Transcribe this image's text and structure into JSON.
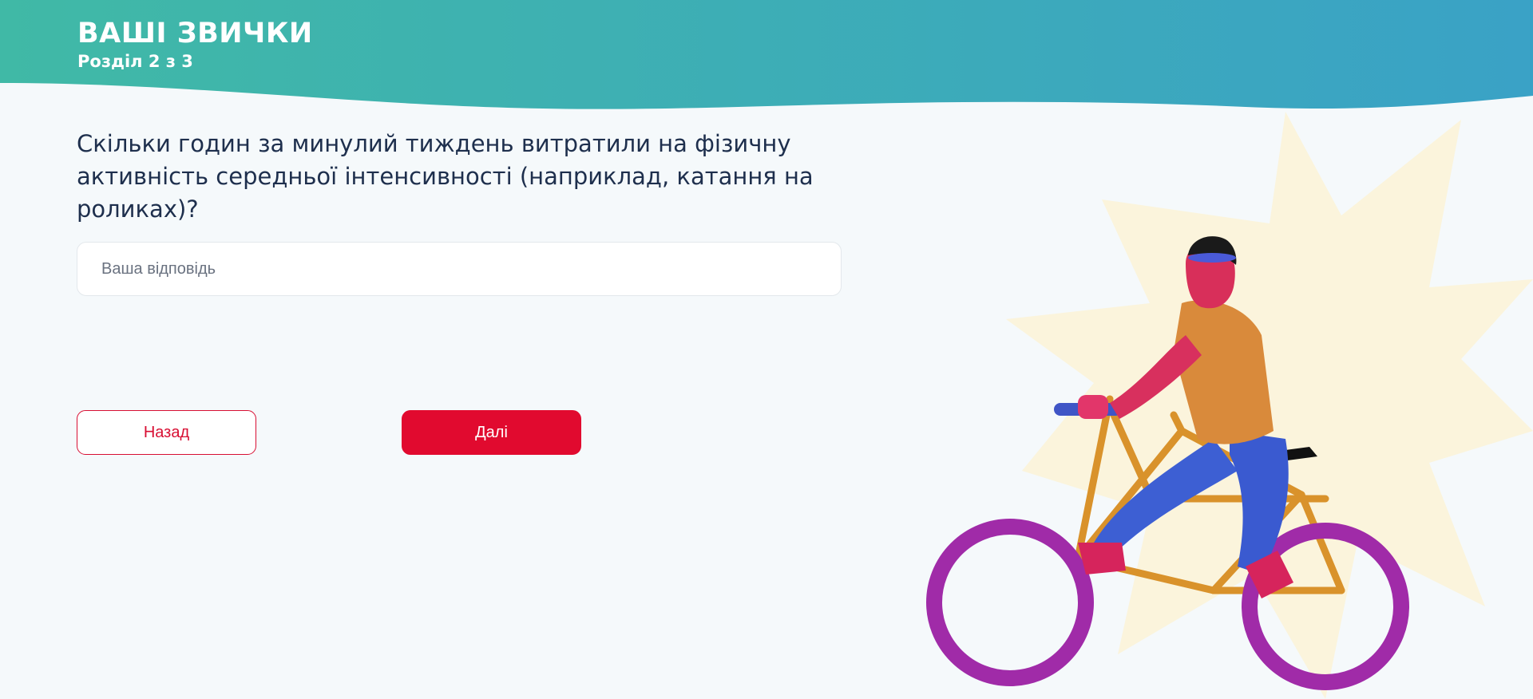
{
  "header": {
    "title": "ВАШІ ЗВИЧКИ",
    "subtitle": "Розділ 2 з 3"
  },
  "question": {
    "text": "Скільки годин за минулий тиждень витратили на фізичну активність середньої інтенсивності (наприклад, катання на роликах)?"
  },
  "answer": {
    "placeholder": "Ваша відповідь",
    "value": ""
  },
  "buttons": {
    "back_label": "Назад",
    "next_label": "Далі"
  },
  "colors": {
    "header_gradient_start": "#3fb8a8",
    "header_gradient_end": "#3aa4c4",
    "accent": "#e10a2f",
    "text": "#1e2f4d",
    "background": "#f5f9fb"
  },
  "illustration": {
    "name": "cyclist-illustration"
  }
}
